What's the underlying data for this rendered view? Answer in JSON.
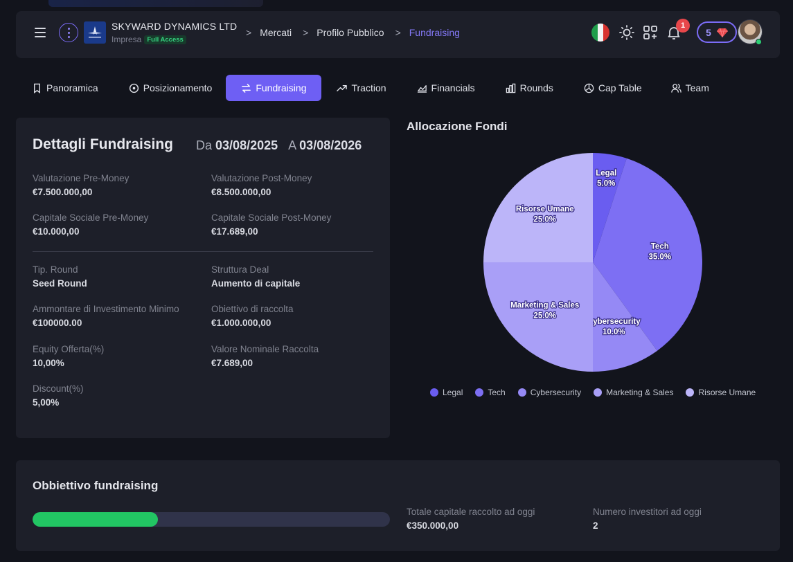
{
  "header": {
    "company_name": "SKYWARD DYNAMICS LTD",
    "company_type": "Impresa",
    "access_badge": "Full Access",
    "breadcrumbs": [
      "Mercati",
      "Profilo Pubblico",
      "Fundraising"
    ],
    "notification_count": "1",
    "credits": "5",
    "icons": [
      "menu-icon",
      "more-vertical-icon",
      "italy-flag-icon",
      "sun-icon",
      "apps-icon",
      "bell-icon",
      "diamond-icon"
    ]
  },
  "tabs": [
    {
      "label": "Panoramica",
      "icon": "bookmark-icon",
      "active": false
    },
    {
      "label": "Posizionamento",
      "icon": "target-icon",
      "active": false
    },
    {
      "label": "Fundraising",
      "icon": "swap-icon",
      "active": true
    },
    {
      "label": "Traction",
      "icon": "trending-up-icon",
      "active": false
    },
    {
      "label": "Financials",
      "icon": "area-chart-icon",
      "active": false
    },
    {
      "label": "Rounds",
      "icon": "bar-chart-icon",
      "active": false
    },
    {
      "label": "Cap Table",
      "icon": "pie-chart-icon",
      "active": false
    },
    {
      "label": "Team",
      "icon": "users-icon",
      "active": false
    }
  ],
  "details": {
    "title": "Dettagli Fundraising",
    "from_label": "Da",
    "from_date": "03/08/2025",
    "to_label": "A",
    "to_date": "03/08/2026",
    "fields": [
      {
        "label": "Valutazione Pre-Money",
        "value": "€7.500.000,00"
      },
      {
        "label": "Valutazione Post-Money",
        "value": "€8.500.000,00"
      },
      {
        "label": "Capitale Sociale Pre-Money",
        "value": "€10.000,00"
      },
      {
        "label": "Capitale Sociale Post-Money",
        "value": "€17.689,00"
      },
      {
        "label": "Tip. Round",
        "value": "Seed Round"
      },
      {
        "label": "Struttura Deal",
        "value": "Aumento di capitale"
      },
      {
        "label": "Ammontare di Investimento Minimo",
        "value": "€100000.00"
      },
      {
        "label": "Obiettivo di raccolta",
        "value": "€1.000.000,00"
      },
      {
        "label": "Equity Offerta(%)",
        "value": "10,00%"
      },
      {
        "label": "Valore Nominale Raccolta",
        "value": "€7.689,00"
      },
      {
        "label": "Discount(%)",
        "value": "5,00%"
      }
    ]
  },
  "chart_data": {
    "type": "pie",
    "title": "Allocazione Fondi",
    "categories": [
      "Legal",
      "Tech",
      "Cybersecurity",
      "Marketing & Sales",
      "Risorse Umane"
    ],
    "values": [
      5.0,
      35.0,
      10.0,
      25.0,
      25.0
    ],
    "labels": [
      "5.0%",
      "35.0%",
      "10.0%",
      "25.0%",
      "25.0%"
    ],
    "colors": [
      "#6a5df0",
      "#7d6ff3",
      "#9589f5",
      "#a99ff7",
      "#bcb5f9"
    ],
    "legend": "bottom"
  },
  "goal": {
    "title": "Obbiettivo fundraising",
    "progress": 0.35,
    "raised_label": "Totale capitale raccolto ad oggi",
    "raised_value": "€350.000,00",
    "investors_label": "Numero investitori ad oggi",
    "investors_value": "2",
    "progress_color": "#22c563"
  }
}
